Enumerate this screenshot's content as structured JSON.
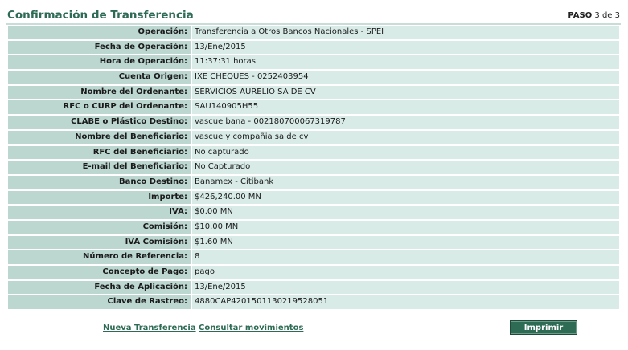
{
  "header": {
    "title": "Confirmación de Transferencia",
    "step_label": "PASO",
    "step_value": "3 de 3"
  },
  "rows": [
    {
      "label": "Operación:",
      "value": "Transferencia a Otros Bancos Nacionales - SPEI"
    },
    {
      "label": "Fecha de Operación:",
      "value": "13/Ene/2015"
    },
    {
      "label": "Hora de Operación:",
      "value": "11:37:31 horas"
    },
    {
      "label": "Cuenta Origen:",
      "value": "IXE CHEQUES - 0252403954"
    },
    {
      "label": "Nombre del Ordenante:",
      "value": "SERVICIOS AURELIO SA DE CV"
    },
    {
      "label": "RFC o CURP del Ordenante:",
      "value": "SAU140905H55"
    },
    {
      "label": "CLABE o Plástico Destino:",
      "value": "vascue bana - 002180700067319787"
    },
    {
      "label": "Nombre del Beneficiario:",
      "value": "vascue y compañia sa de cv"
    },
    {
      "label": "RFC del Beneficiario:",
      "value": "No capturado"
    },
    {
      "label": "E-mail del Beneficiario:",
      "value": "No Capturado"
    },
    {
      "label": "Banco Destino:",
      "value": "Banamex - Citibank"
    },
    {
      "label": "Importe:",
      "value": "$426,240.00 MN"
    },
    {
      "label": "IVA:",
      "value": "$0.00 MN"
    },
    {
      "label": "Comisión:",
      "value": "$10.00 MN"
    },
    {
      "label": "IVA Comisión:",
      "value": "$1.60 MN"
    },
    {
      "label": "Número de Referencia:",
      "value": "8"
    },
    {
      "label": "Concepto de Pago:",
      "value": "pago"
    },
    {
      "label": "Fecha de Aplicación:",
      "value": "13/Ene/2015"
    },
    {
      "label": "Clave de Rastreo:",
      "value": "4880CAP4201501130219528051"
    }
  ],
  "actions": {
    "new_transfer": "Nueva Transferencia",
    "view_movements": "Consultar movimientos",
    "print": "Imprimir"
  },
  "colors": {
    "accent": "#2e6b55",
    "label_bg": "#bcd6d0",
    "value_bg": "#d8ebe7"
  }
}
